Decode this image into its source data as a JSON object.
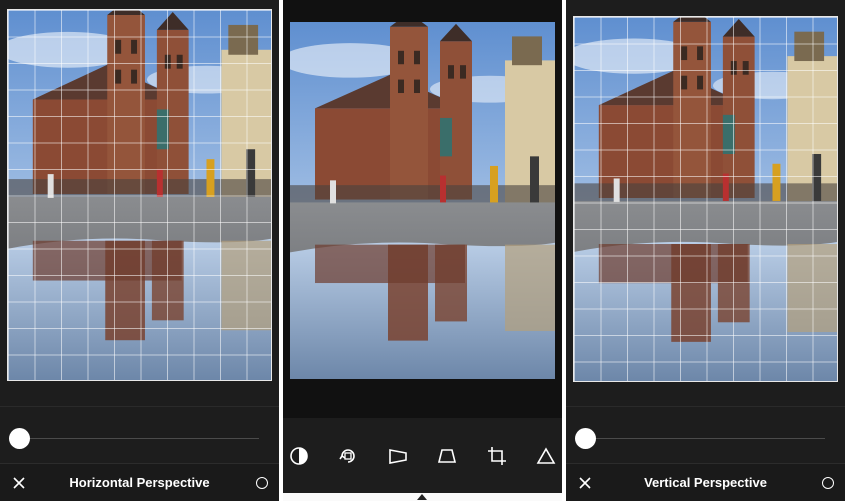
{
  "left_screen": {
    "slider_value_fraction": 0.0,
    "bottom_bar": {
      "title": "Horizontal Perspective",
      "close_icon": "close-icon",
      "confirm_icon": "circle-icon"
    }
  },
  "center_screen": {
    "toolbar": [
      {
        "icon": "contrast-icon"
      },
      {
        "icon": "rotate-icon"
      },
      {
        "icon": "horizontal-perspective-icon"
      },
      {
        "icon": "vertical-perspective-icon"
      },
      {
        "icon": "crop-icon"
      },
      {
        "icon": "triangle-icon"
      }
    ]
  },
  "right_screen": {
    "slider_value_fraction": 0.0,
    "bottom_bar": {
      "title": "Vertical Perspective",
      "close_icon": "close-icon",
      "confirm_icon": "circle-icon"
    }
  },
  "colors": {
    "background": "#1d1d1d",
    "accent": "#ffffff",
    "sky": "#7fa6d6",
    "brick": "#8a4a33"
  }
}
